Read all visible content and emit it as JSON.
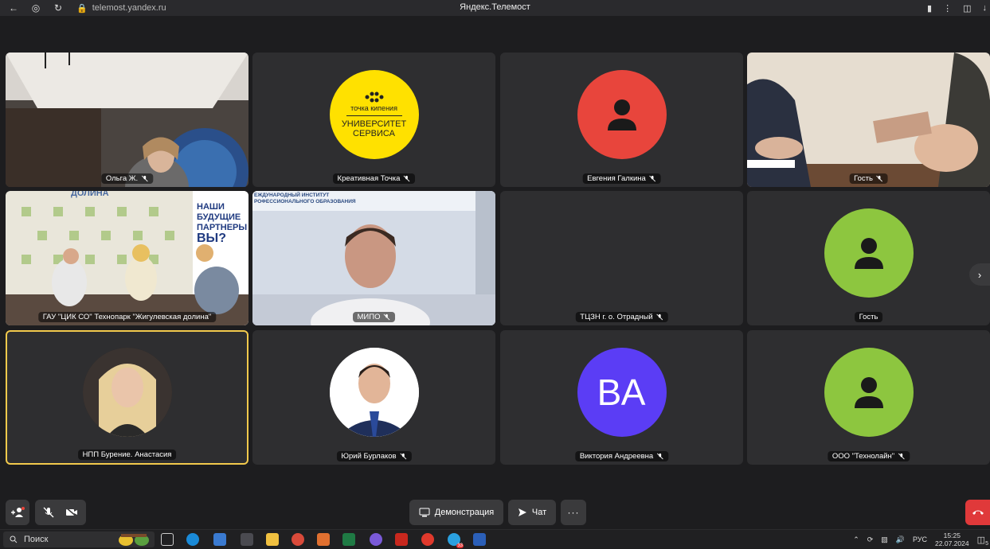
{
  "browser": {
    "url": "telemost.yandex.ru",
    "title": "Яндекс.Телемост"
  },
  "participants": [
    {
      "name": "Ольга Ж.",
      "type": "video",
      "muted": true
    },
    {
      "name": "Креативная Точка",
      "type": "logo",
      "muted": true,
      "logo_top": "точка кипения",
      "logo_line1": "УНИВЕРСИТЕТ",
      "logo_line2": "СЕРВИСА",
      "color": "#ffe100"
    },
    {
      "name": "Евгения Галкина",
      "type": "avatar",
      "muted": true,
      "color": "#e8453c"
    },
    {
      "name": "Гость",
      "type": "video",
      "muted": true
    },
    {
      "name": "ГАУ \"ЦИК СО\" Технопарк \"Жигулевская долина\"",
      "type": "video",
      "muted": false,
      "banner_lines": [
        "НАШИ",
        "БУДУЩИЕ",
        "ПАРТНЕРЫ",
        "ВЫ?"
      ],
      "banner_top": "ДОЛИНА"
    },
    {
      "name": "МИПО",
      "type": "video",
      "muted": true,
      "wall_text": "ЕЖДУНАРОДНЫЙ ИНСТИТУТ РОФЕССИОНАЛЬНОГО ОБРАЗОВАНИЯ"
    },
    {
      "name": "ТЦЗН г. о. Отрадный",
      "type": "empty",
      "muted": true
    },
    {
      "name": "Гость",
      "type": "avatar",
      "muted": false,
      "color": "#8dc63f"
    },
    {
      "name": "НПП Бурение. Анастасия",
      "type": "photo",
      "muted": false,
      "active": true
    },
    {
      "name": "Юрий Бурлаков",
      "type": "photo",
      "muted": true
    },
    {
      "name": "Виктория Андреевна",
      "type": "initials",
      "muted": true,
      "initials": "ВА",
      "color": "#5b3df5"
    },
    {
      "name": "ООО \"Технолайн\"",
      "type": "avatar",
      "muted": true,
      "color": "#8dc63f"
    }
  ],
  "controls": {
    "demo_label": "Демонстрация",
    "chat_label": "Чат",
    "more_label": "···"
  },
  "taskbar": {
    "search_placeholder": "Поиск",
    "lang": "РУС",
    "time": "15:25",
    "date": "22.07.2024",
    "notif_count": "5",
    "yandex_badge": "33"
  }
}
